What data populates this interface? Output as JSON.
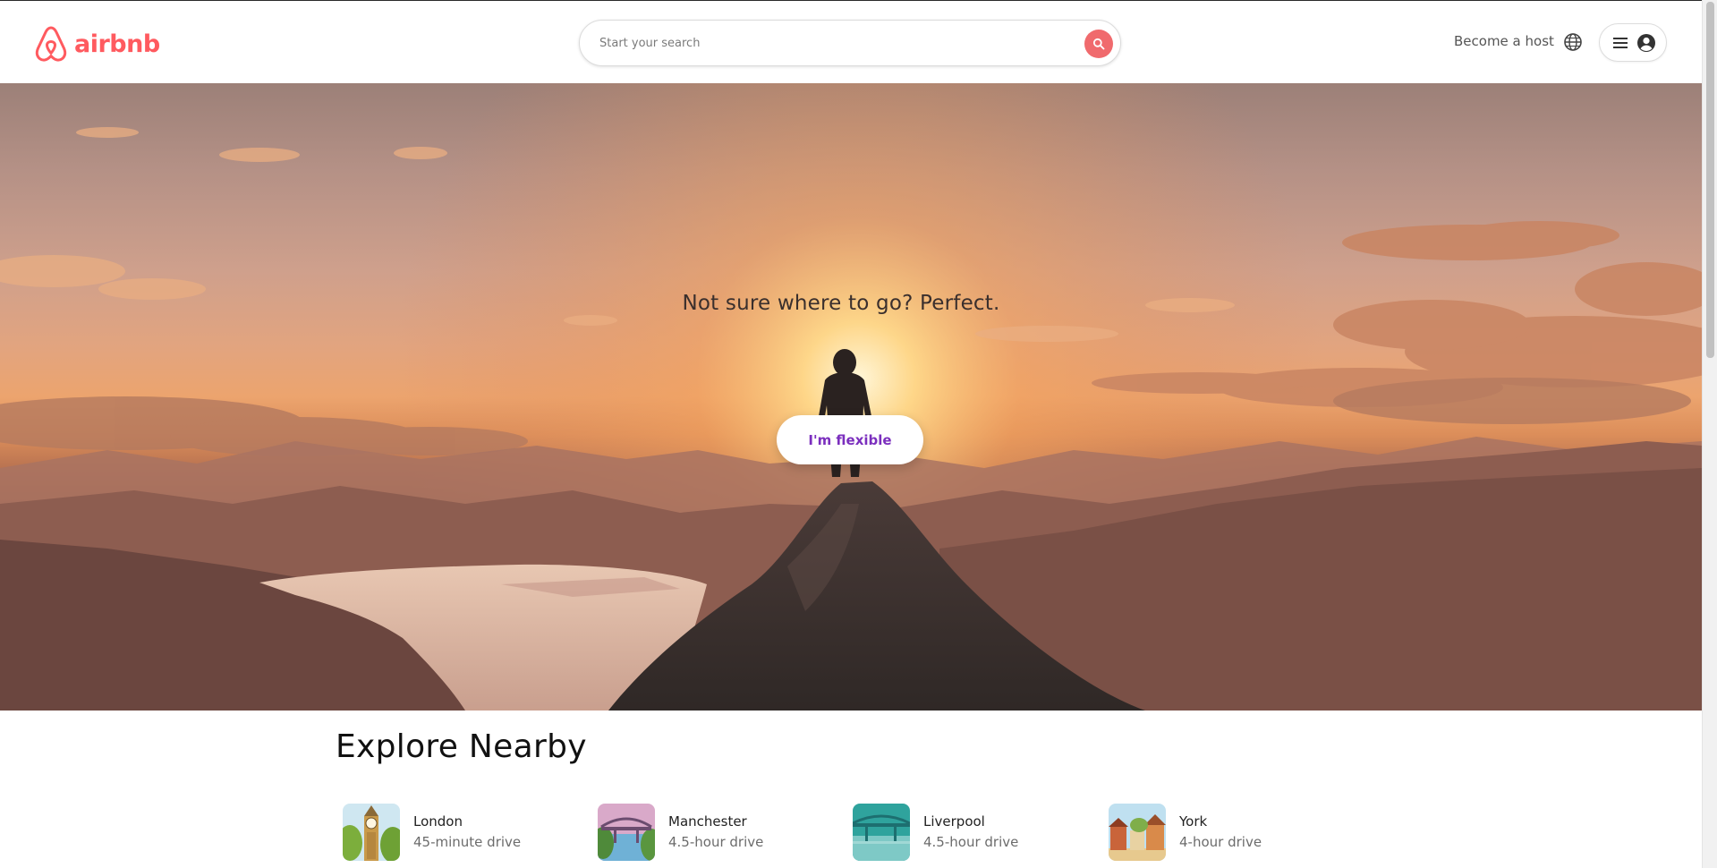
{
  "brand": {
    "name": "airbnb",
    "accent_color": "#ff5a5f"
  },
  "header": {
    "search": {
      "placeholder": "Start your search",
      "value": "",
      "button_icon": "search-icon",
      "button_color": "#f06a6d"
    },
    "host_link": "Become a host",
    "language_icon": "globe-icon",
    "menu_icons": [
      "hamburger-menu-icon",
      "user-avatar-icon"
    ]
  },
  "hero": {
    "headline": "Not sure where to go? Perfect.",
    "cta_label": "I'm flexible",
    "cta_color": "#7b2fbe"
  },
  "explore": {
    "title": "Explore Nearby",
    "places": [
      {
        "name": "London",
        "drive": "45-minute drive"
      },
      {
        "name": "Manchester",
        "drive": "4.5-hour drive"
      },
      {
        "name": "Liverpool",
        "drive": "4.5-hour drive"
      },
      {
        "name": "York",
        "drive": "4-hour drive"
      }
    ]
  }
}
